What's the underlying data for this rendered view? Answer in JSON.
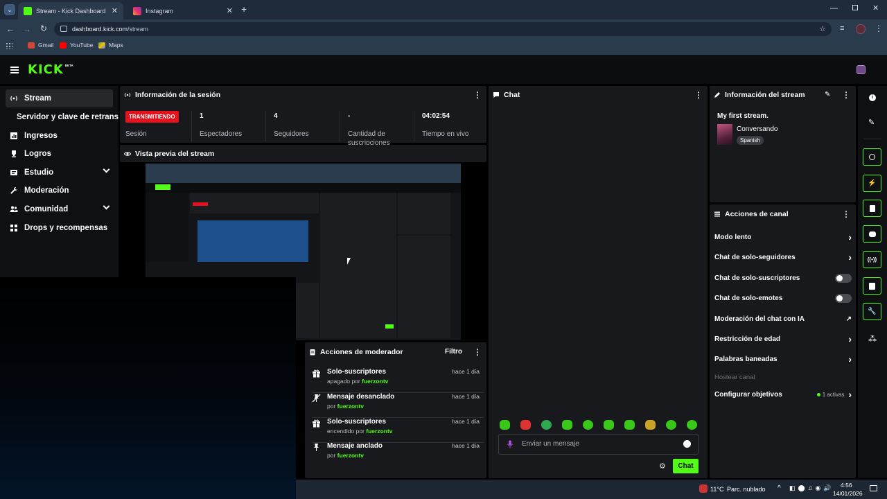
{
  "browser": {
    "tabs": [
      {
        "label": "Stream - Kick Dashboard",
        "color": "#53fc18"
      },
      {
        "label": "Instagram",
        "color": "#e1306c"
      }
    ],
    "url_host": "dashboard.kick.com",
    "url_path": "/stream",
    "bookmarks": [
      {
        "label": "Gmail"
      },
      {
        "label": "YouTube"
      },
      {
        "label": "Maps"
      }
    ]
  },
  "app": {
    "logo": "KICK",
    "logo_badge": "BETA",
    "accent": "#53fc18"
  },
  "sidebar": {
    "items": [
      {
        "label": "Stream",
        "icon": "broadcast-icon"
      },
      {
        "label": "Servidor y clave de retransm"
      },
      {
        "label": "Ingresos",
        "icon": "chart-icon"
      },
      {
        "label": "Logros",
        "icon": "trophy-icon"
      },
      {
        "label": "Estudio",
        "icon": "studio-icon"
      },
      {
        "label": "Moderación",
        "icon": "wrench-icon"
      },
      {
        "label": "Comunidad",
        "icon": "people-icon"
      },
      {
        "label": "Drops y recompensas",
        "icon": "drops-icon"
      }
    ]
  },
  "session": {
    "title": "Información de la sesión",
    "status_badge": "TRANSMITIENDO",
    "status_label": "Sesión",
    "stats": [
      {
        "value": "1",
        "label": "Espectadores"
      },
      {
        "value": "4",
        "label": "Seguidores"
      },
      {
        "value": "-",
        "label": "Cantidad de suscripciones"
      },
      {
        "value": "04:02:54",
        "label": "Tiempo en vivo"
      }
    ]
  },
  "preview": {
    "title": "Vista previa del stream"
  },
  "chat": {
    "title": "Chat",
    "placeholder": "Enviar un mensaje",
    "send_label": "Chat"
  },
  "stream_info": {
    "title": "Información del stream",
    "stream_title": "My first stream.",
    "category": "Conversando",
    "language": "Spanish"
  },
  "channel_actions": {
    "title": "Acciones de canal",
    "items": [
      {
        "label": "Modo lento"
      },
      {
        "label": "Chat de solo-seguidores"
      },
      {
        "label": "Chat de solo-suscriptores"
      },
      {
        "label": "Chat de solo-emotes"
      },
      {
        "label": "Moderación del chat con IA"
      },
      {
        "label": "Restricción de edad"
      },
      {
        "label": "Palabras baneadas"
      },
      {
        "label": "Hostear canal"
      },
      {
        "label": "Configurar objetivos",
        "badge": "1 activas"
      }
    ]
  },
  "mod_actions": {
    "title": "Acciones de moderador",
    "filter_label": "Filtro",
    "entries": [
      {
        "title": "Solo-suscriptores",
        "action": "apagado por",
        "user": "fuerzontv",
        "time": "hace 1 día"
      },
      {
        "title": "Mensaje desanclado",
        "action": "por",
        "user": "fuerzontv",
        "time": "hace 1 día"
      },
      {
        "title": "Solo-suscriptores",
        "action": "encendido por",
        "user": "fuerzontv",
        "time": "hace 1 día"
      },
      {
        "title": "Mensaje anclado",
        "action": "por",
        "user": "fuerzontv",
        "time": "hace 1 día"
      }
    ]
  },
  "taskbar": {
    "temp": "11°C",
    "weather": "Parc. nublado",
    "time": "4:56",
    "date": "14/01/2026"
  }
}
